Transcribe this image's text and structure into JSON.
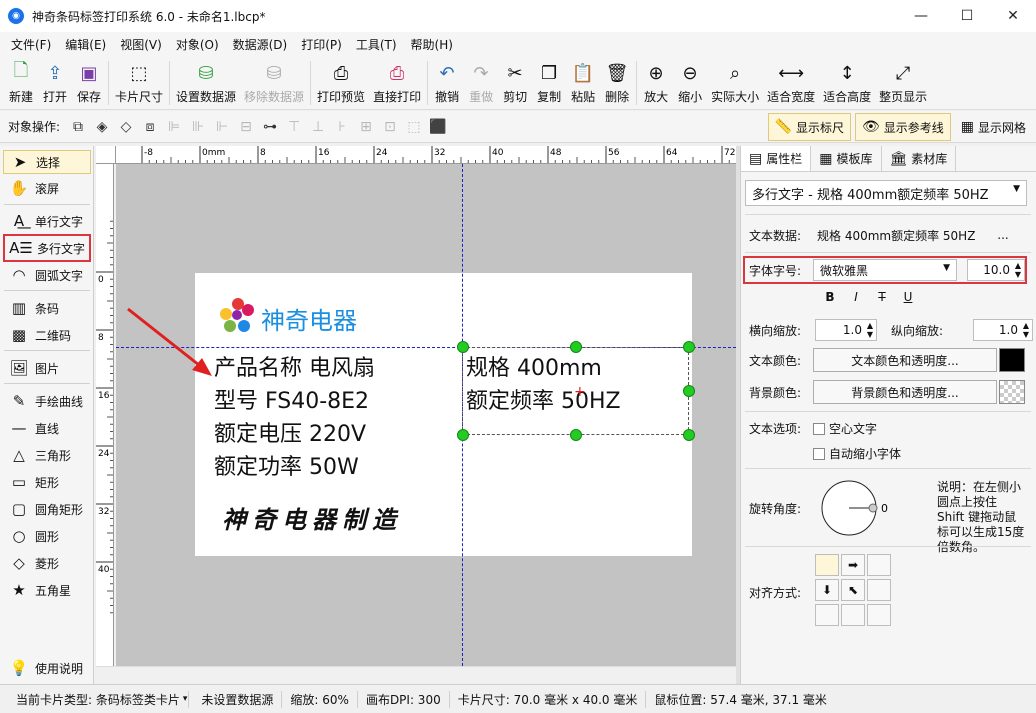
{
  "window": {
    "title": "神奇条码标签打印系统 6.0 - 未命名1.lbcp*"
  },
  "menu": [
    "文件(F)",
    "编辑(E)",
    "视图(V)",
    "对象(O)",
    "数据源(D)",
    "打印(P)",
    "工具(T)",
    "帮助(H)"
  ],
  "toolbar": {
    "new": "新建",
    "open": "打开",
    "save": "保存",
    "card_size": "卡片尺寸",
    "set_datasource": "设置数据源",
    "remove_datasource": "移除数据源",
    "print_preview": "打印预览",
    "direct_print": "直接打印",
    "undo": "撤销",
    "redo": "重做",
    "cut": "剪切",
    "copy": "复制",
    "paste": "粘贴",
    "delete": "删除",
    "zoom_in": "放大",
    "zoom_out": "缩小",
    "actual_size": "实际大小",
    "fit_width": "适合宽度",
    "fit_height": "适合高度",
    "fit_page": "整页显示"
  },
  "ops": {
    "label": "对象操作:",
    "show_ruler": "显示标尺",
    "show_guides": "显示参考线",
    "show_grid": "显示网格"
  },
  "tools": {
    "select": "选择",
    "scroll": "滚屏",
    "single_text": "单行文字",
    "multi_text": "多行文字",
    "arc_text": "圆弧文字",
    "barcode": "条码",
    "qrcode": "二维码",
    "image": "图片",
    "freehand": "手绘曲线",
    "line": "直线",
    "triangle": "三角形",
    "rectangle": "矩形",
    "rounded_rect": "圆角矩形",
    "circle": "圆形",
    "diamond": "菱形",
    "star": "五角星",
    "help": "使用说明"
  },
  "ruler": {
    "top": [
      "-8",
      "0mm",
      "8",
      "16",
      "24",
      "32",
      "40",
      "48",
      "56",
      "64",
      "72"
    ],
    "left": [
      "0",
      "8",
      "16",
      "24",
      "32",
      "40"
    ]
  },
  "label": {
    "brand": "神奇电器",
    "lines_left": [
      "产品名称   电风扇",
      "型号    FS40-8E2",
      "额定电压 220V",
      "额定功率 50W"
    ],
    "lines_right": [
      "规格 400mm",
      "额定频率 50HZ"
    ],
    "signature": "神奇电器制造"
  },
  "panel": {
    "tabs": [
      "属性栏",
      "模板库",
      "素材库"
    ],
    "object_combo": "多行文字 - 规格 400mm额定频率 50HZ",
    "text_data_label": "文本数据:",
    "text_data_value": "规格 400mm额定频率 50HZ",
    "text_data_more": "...",
    "font_label": "字体字号:",
    "font_name": "微软雅黑",
    "font_size": "10.0",
    "bold": "B",
    "italic": "I",
    "strike": "T",
    "underline": "U",
    "hscale_label": "横向缩放:",
    "hscale": "1.0",
    "vscale_label": "纵向缩放:",
    "vscale": "1.0",
    "text_color_label": "文本颜色:",
    "text_color_btn": "文本颜色和透明度...",
    "bg_color_label": "背景颜色:",
    "bg_color_btn": "背景颜色和透明度...",
    "text_options_label": "文本选项:",
    "hollow_text": "空心文字",
    "auto_shrink": "自动缩小字体",
    "rotation_label": "旋转角度:",
    "rotation_value": "0",
    "rotation_hint": "说明：在左侧小圆点上按住 Shift 键拖动鼠标可以生成15度倍数角。",
    "align_label": "对齐方式:"
  },
  "status": {
    "card_type": "当前卡片类型: 条码标签类卡片",
    "datasource": "未设置数据源",
    "zoom": "缩放: 60%",
    "dpi": "画布DPI: 300",
    "card_size": "卡片尺寸: 70.0 毫米 x 40.0 毫米",
    "mouse_pos": "鼠标位置: 57.4 毫米, 37.1 毫米"
  },
  "colors": {
    "accent_red": "#d9363e",
    "handle_green": "#22cc22",
    "brand_blue": "#1a8fe0"
  }
}
